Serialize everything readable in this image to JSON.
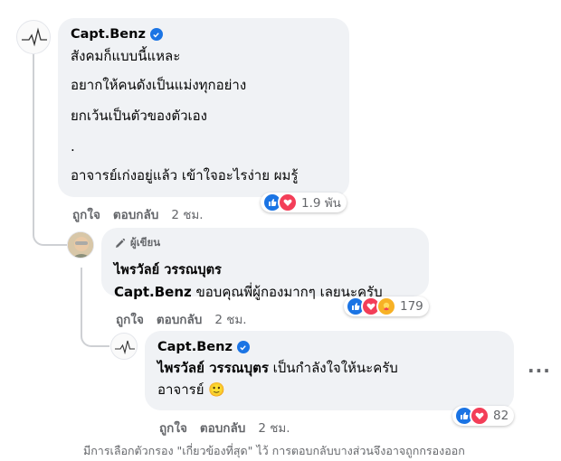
{
  "comment1": {
    "author": "Capt.Benz",
    "lines": [
      "สังคมก็แบบนี้แหละ",
      "อยากให้คนดังเป็นแม่งทุกอย่าง",
      "ยกเว้นเป็นตัวของตัวเอง",
      ".",
      "อาจารย์เก่งอยู่แล้ว เข้าใจอะไรง่าย ผมรู้"
    ],
    "reaction_count": "1.9 พัน",
    "like_label": "ถูกใจ",
    "reply_label": "ตอบกลับ",
    "time": "2 ชม."
  },
  "comment2": {
    "author_badge": "ผู้เขียน",
    "author": "ไพรวัลย์ วรรณบุตร",
    "mention": "Capt.Benz",
    "text": " ขอบคุณพี่ผู้กองมากๆ เลยนะครับ",
    "reaction_count": "179",
    "like_label": "ถูกใจ",
    "reply_label": "ตอบกลับ",
    "time": "2 ชม."
  },
  "comment3": {
    "author": "Capt.Benz",
    "mention": "ไพรวัลย์ วรรณบุตร",
    "text": " เป็นกำลังใจให้นะครับ",
    "text2": "อาจารย์ 🙂",
    "reaction_count": "82",
    "like_label": "ถูกใจ",
    "reply_label": "ตอบกลับ",
    "time": "2 ชม.",
    "more_label": "···"
  },
  "footer_note": "มีการเลือกตัวกรอง \"เกี่ยวข้องที่สุด\" ไว้ การตอบกลับบางส่วนจึงอาจถูกกรองออก",
  "colors": {
    "like": "#1b74e4",
    "love": "#f33e58",
    "care": "#f7b125",
    "bubble": "#f0f2f5",
    "meta": "#65676b"
  }
}
